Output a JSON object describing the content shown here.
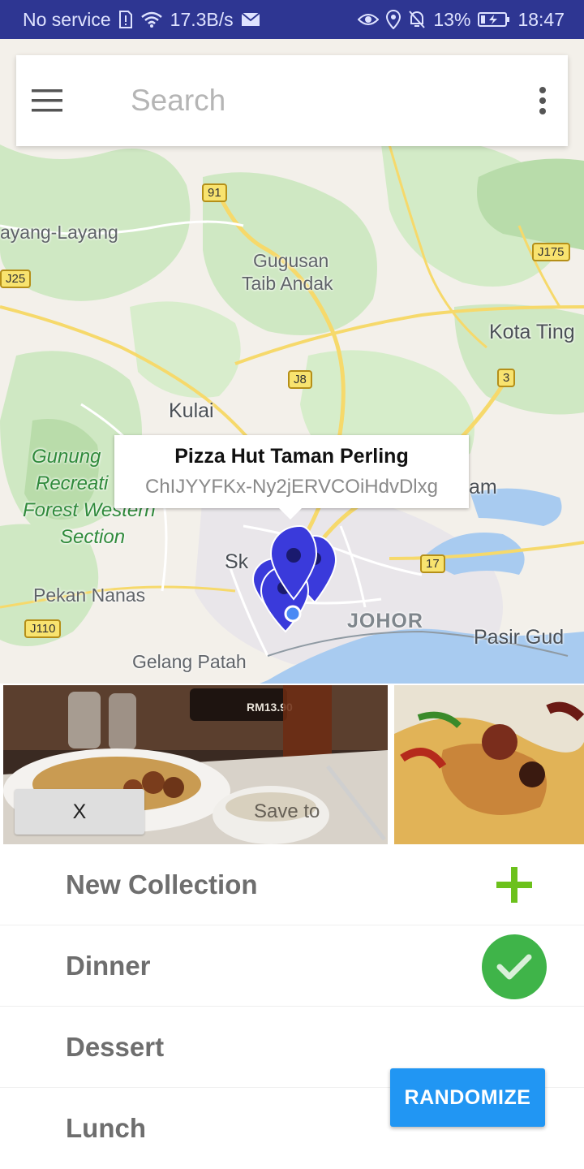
{
  "status_bar": {
    "carrier": "No service",
    "speed": "17.3B/s",
    "battery_pct": "13%",
    "time": "18:47"
  },
  "search": {
    "placeholder": "Search"
  },
  "map": {
    "labels": {
      "layang": "ayang-Layang",
      "gugusan": "Gugusan",
      "taib": "Taib Andak",
      "kota_tinggi": "Kota Ting",
      "kulai": "Kulai",
      "gunung_1": "Gunung",
      "gunung_2": "Recreati",
      "gunung_3": "Forest Western",
      "gunung_4": "Section",
      "sk": "Sk",
      "am": "am",
      "pekan_nanas": "Pekan Nanas",
      "johor": "JOHOR",
      "pasir_gudang": "Pasir Gud",
      "gelang_patah": "Gelang Patah"
    },
    "road_shields": {
      "r91": "91",
      "j25": "J25",
      "j175": "J175",
      "j8": "J8",
      "r3": "3",
      "r17": "17",
      "j110": "J110"
    }
  },
  "info_window": {
    "title": "Pizza Hut Taman Perling",
    "place_id": "ChIJYYFKx-Ny2jERVCOiHdvDlxg"
  },
  "photo_actions": {
    "close_label": "X",
    "save_to_label": "Save to"
  },
  "collections": [
    {
      "label": "New Collection"
    },
    {
      "label": "Dinner"
    },
    {
      "label": "Dessert"
    },
    {
      "label": "Lunch"
    }
  ],
  "randomize_label": "RANDOMIZE",
  "colors": {
    "status_bar": "#2e3692",
    "marker": "#3a3adb",
    "accent_button": "#2196f3",
    "check_green": "#3fb449",
    "plus_green": "#6cc11c"
  }
}
